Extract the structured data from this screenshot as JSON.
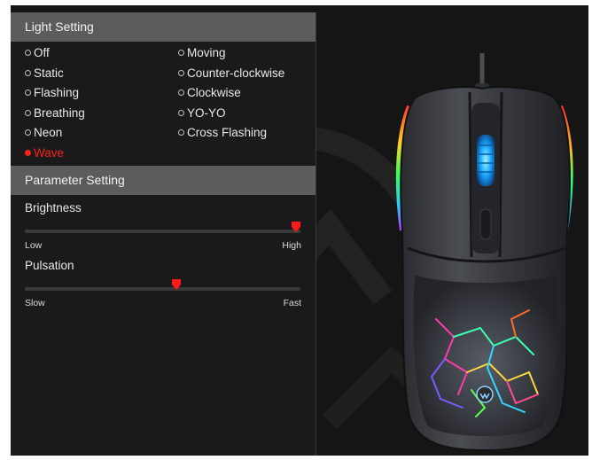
{
  "light_setting": {
    "header": "Light Setting",
    "modes": [
      {
        "label": "Off",
        "selected": false
      },
      {
        "label": "Static",
        "selected": false
      },
      {
        "label": "Flashing",
        "selected": false
      },
      {
        "label": "Breathing",
        "selected": false
      },
      {
        "label": "Neon",
        "selected": false
      },
      {
        "label": "Wave",
        "selected": true
      },
      {
        "label": "Moving",
        "selected": false
      },
      {
        "label": "Counter-clockwise",
        "selected": false
      },
      {
        "label": "Clockwise",
        "selected": false
      },
      {
        "label": "YO-YO",
        "selected": false
      },
      {
        "label": "Cross Flashing",
        "selected": false
      }
    ]
  },
  "parameter_setting": {
    "header": "Parameter Setting",
    "brightness": {
      "label": "Brightness",
      "min_label": "Low",
      "max_label": "High",
      "value_fraction": 0.985
    },
    "pulsation": {
      "label": "Pulsation",
      "min_label": "Slow",
      "max_label": "Fast",
      "value_fraction": 0.55
    }
  },
  "colors": {
    "accent": "#ff2020",
    "header_bg": "#5c5c5c",
    "panel_bg": "#1a1a1a"
  },
  "icons": {
    "slider_thumb": "red-pointer-icon",
    "product": "gaming-mouse-image"
  }
}
